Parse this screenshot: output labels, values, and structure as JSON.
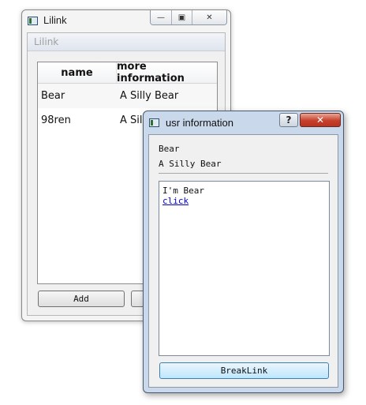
{
  "main_window": {
    "title": "Lilink",
    "inner_title": "Lilink",
    "caption_buttons": {
      "minimize": "—",
      "maximize": "▣",
      "close": "✕"
    },
    "table": {
      "columns": [
        "name",
        "more information"
      ],
      "rows": [
        [
          "Bear",
          "A Silly Bear"
        ],
        [
          "98ren",
          "A Silly"
        ]
      ]
    },
    "add_button": "Add"
  },
  "dialog": {
    "title": "usr information",
    "help_button": "?",
    "close_button": "✕",
    "name": "Bear",
    "info": "A Silly Bear",
    "message_line": "I'm Bear",
    "link_text": "click",
    "break_button": "BreakLink"
  }
}
